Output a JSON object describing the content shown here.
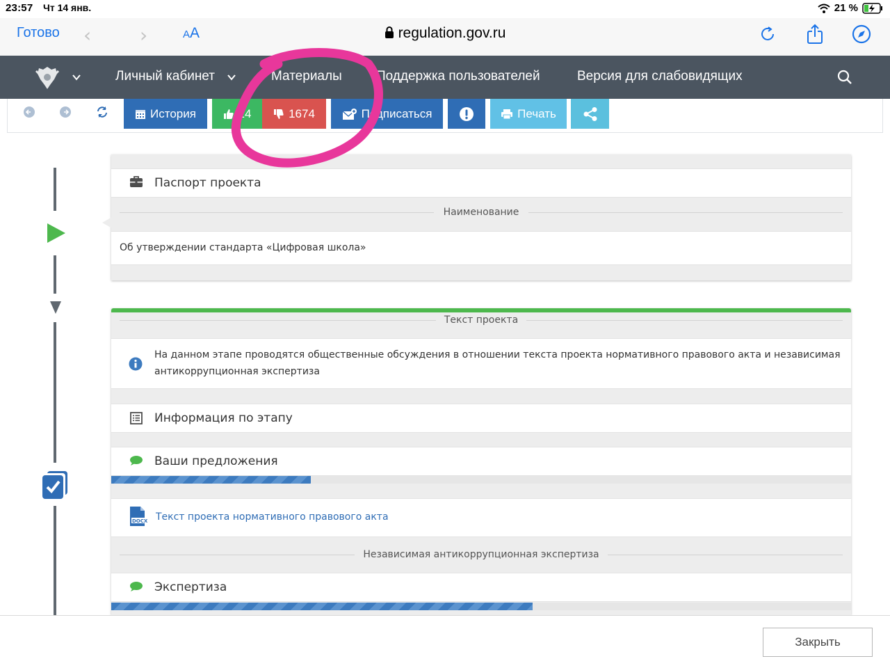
{
  "status_bar": {
    "time": "23:57",
    "date": "Чт 14 янв.",
    "battery": "21 %"
  },
  "safari": {
    "done_label": "Готово",
    "text_size_label": "AA",
    "url": "regulation.gov.ru",
    "back_icon": "back-arrow-icon",
    "forward_icon": "forward-arrow-icon"
  },
  "site_header": {
    "nav": [
      {
        "label": "Личный кабинет"
      },
      {
        "label": "Материалы"
      },
      {
        "label": "Поддержка пользователей"
      },
      {
        "label": "Версия для слабовидящих"
      }
    ]
  },
  "toolbar": {
    "history_label": "История",
    "likes": "14",
    "dislikes": "1674",
    "subscribe_label": "Подписаться",
    "print_label": "Печать",
    "colors": {
      "history": "#2f6db5",
      "like": "#3cb862",
      "dislike": "#d9534f",
      "subscribe": "#2f6db5",
      "report": "#2f6db5",
      "print": "#61c1e6",
      "share": "#5bc0de"
    }
  },
  "passport": {
    "title": "Паспорт проекта",
    "name_header": "Наименование",
    "name_value": "Об утверждении стандарта «Цифровая школа»"
  },
  "project_text": {
    "header": "Текст проекта",
    "info_text_line1": "На данном этапе проводятся общественные обсуждения в отношении текста проекта нормативного правового акта и независимая",
    "info_text_line2": "антикоррупционная экспертиза",
    "stage_info_label": "Информация по этапу",
    "proposals_label": "Ваши предложения",
    "proposals_progress": 0.27,
    "document_link": "Текст проекта нормативного правового акта",
    "expertise_header": "Независимая антикоррупционная экспертиза",
    "expertise_label": "Экспертиза",
    "expertise_progress": 0.57
  },
  "close_label": "Закрыть",
  "colors": {
    "accent": "#2f6db5",
    "green": "#4db84d",
    "header_bg": "#4b5560",
    "annotation": "#e8379b"
  }
}
